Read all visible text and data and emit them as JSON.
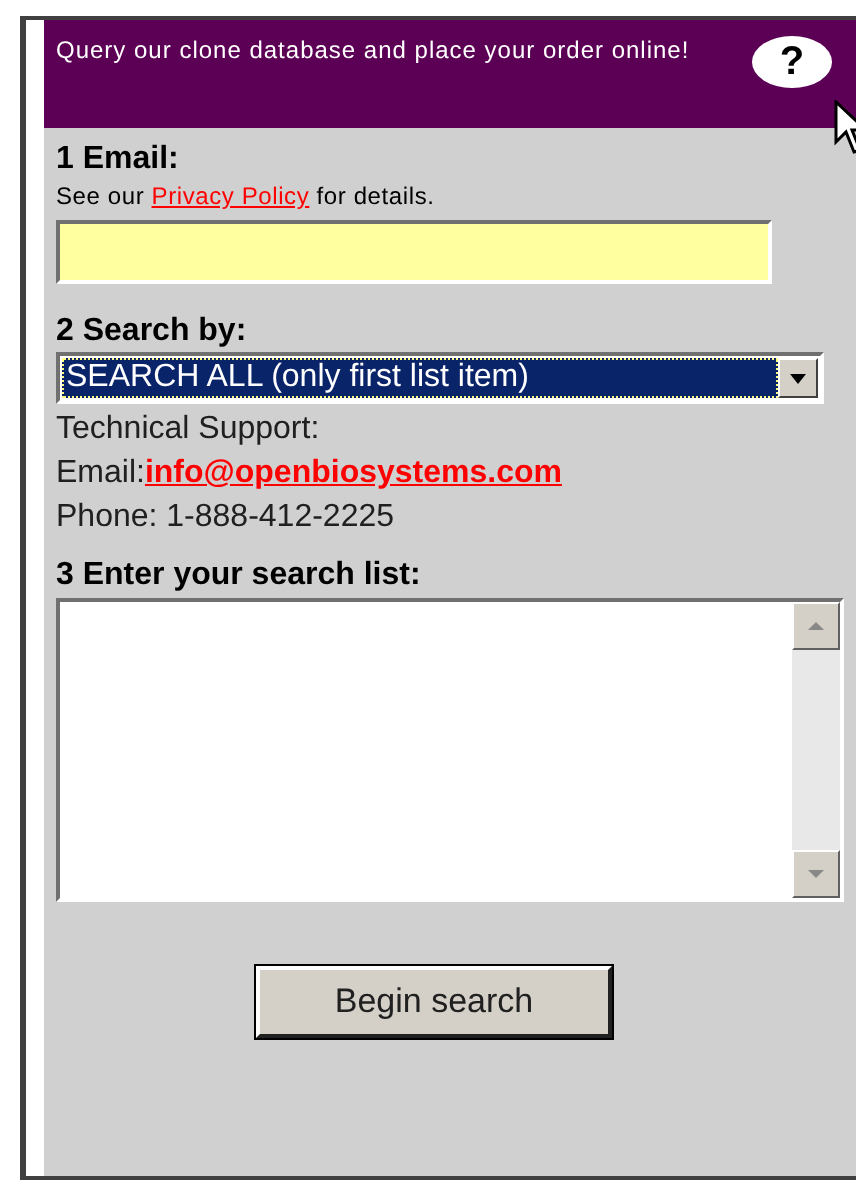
{
  "header": {
    "text": "Query our clone database and place your order online!",
    "help": "?"
  },
  "email": {
    "label": "1 Email:",
    "note_prefix": "See our ",
    "note_link": "Privacy Policy",
    "note_suffix": " for details."
  },
  "search_by": {
    "label": "2 Search by:",
    "value": "SEARCH ALL (only first list item)"
  },
  "support": {
    "title": "Technical Support:",
    "email_label": "Email:",
    "email_link": "info@openbiosystems.com",
    "phone": "Phone: 1-888-412-2225"
  },
  "search_list": {
    "label": "3 Enter your search list:"
  },
  "button": "Begin search"
}
